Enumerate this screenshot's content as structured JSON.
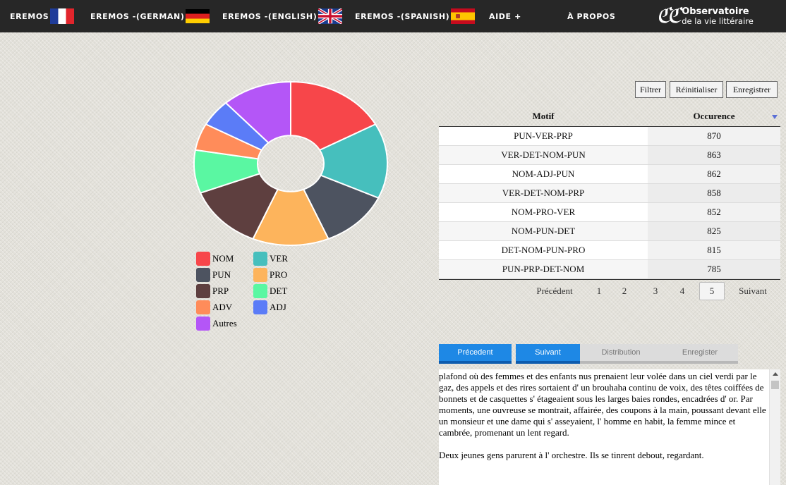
{
  "nav": {
    "items": [
      {
        "label": "Eremos",
        "flag": "france-flag"
      },
      {
        "label": "Eremos -(German)",
        "flag": "germany-flag"
      },
      {
        "label": "Eremos -(English)",
        "flag": "uk-flag"
      },
      {
        "label": "Eremos -(Spanish)",
        "flag": "spain-flag"
      },
      {
        "label": "Aide +"
      },
      {
        "label": "À propos"
      }
    ],
    "logo": {
      "line1": "Observatoire",
      "line2": "de la vie littéraire",
      "icon": "observatoire-logo-icon"
    }
  },
  "toolbar": {
    "filter_label": "Filtrer",
    "reset_label": "Réinitialiser",
    "save_label": "Enregistrer"
  },
  "chart_data": {
    "type": "pie",
    "variant": "donut",
    "categories": [
      "NOM",
      "VER",
      "PUN",
      "PRO",
      "PRP",
      "DET",
      "ADV",
      "ADJ",
      "Autres"
    ],
    "values": [
      16,
      14,
      11,
      12,
      12,
      8,
      5,
      5,
      11
    ],
    "colors": [
      "#f7464a",
      "#46bfbd",
      "#4d5360",
      "#fdb45c",
      "#5e3f3f",
      "#5af7a2",
      "#ff8c5a",
      "#5b7cf7",
      "#b456f7"
    ],
    "legend_position": "bottom"
  },
  "table": {
    "headers": {
      "motif": "Motif",
      "occurrence": "Occurence"
    },
    "rows": [
      {
        "motif": "PUN-VER-PRP",
        "occ": "870"
      },
      {
        "motif": "VER-DET-NOM-PUN",
        "occ": "863"
      },
      {
        "motif": "NOM-ADJ-PUN",
        "occ": "862"
      },
      {
        "motif": "VER-DET-NOM-PRP",
        "occ": "858"
      },
      {
        "motif": "NOM-PRO-VER",
        "occ": "852"
      },
      {
        "motif": "NOM-PUN-DET",
        "occ": "825"
      },
      {
        "motif": "DET-NOM-PUN-PRO",
        "occ": "815"
      },
      {
        "motif": "PUN-PRP-DET-NOM",
        "occ": "785"
      }
    ]
  },
  "pagination": {
    "prev_label": "Précédent",
    "pages": [
      "1",
      "2",
      "3",
      "4",
      "5"
    ],
    "current_page": "5",
    "next_label": "Suivant"
  },
  "panel": {
    "tabs": [
      {
        "label": "Précedent",
        "state": "active"
      },
      {
        "label": "Suivant",
        "state": "active"
      },
      {
        "label": "Distribution",
        "state": "inactive"
      },
      {
        "label": "Enregister",
        "state": "inactive"
      }
    ],
    "paragraphs": [
      "plafond où des femmes et des enfants nus prenaient leur volée dans un ciel verdi par le gaz, des appels et des rires sortaient d' un brouhaha continu de voix, des têtes coiffées de bonnets et de casquettes s' étageaient sous les larges baies rondes, encadrées d' or. Par moments, une ouvreuse se montrait, affairée, des coupons à la main, poussant devant elle un monsieur et une dame qui s' asseyaient, l' homme en habit, la femme mince et cambrée, promenant un lent regard.",
      "Deux jeunes gens parurent à l' orchestre. Ils se tinrent debout, regardant."
    ]
  }
}
